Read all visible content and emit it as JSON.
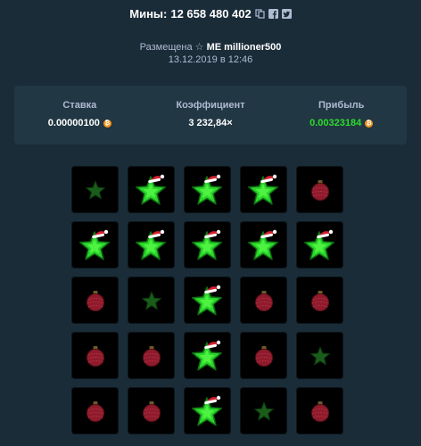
{
  "header": {
    "title_prefix": "Мины: ",
    "game_id": "12 658 480 402",
    "icons": [
      "copy-icon",
      "facebook-icon",
      "twitter-icon"
    ]
  },
  "meta": {
    "posted_label": "Размещена",
    "user_level": "ME",
    "username": "millioner500",
    "datetime": "13.12.2019 в 12:46"
  },
  "stats": {
    "bet_label": "Ставка",
    "bet_value": "0.00000100",
    "multiplier_label": "Коэффициент",
    "multiplier_value": "3 232,84×",
    "profit_label": "Прибыль",
    "profit_value": "0.00323184",
    "currency_icon": "bitcoin-icon"
  },
  "colors": {
    "background": "#1a2c38",
    "panel": "#213743",
    "profit_green": "#2ddc2d",
    "gem": "#2bd52b",
    "mine": "#8e1b2b"
  },
  "board": [
    [
      "star-dim",
      "star",
      "star",
      "star",
      "mine"
    ],
    [
      "star",
      "star",
      "star",
      "star",
      "star"
    ],
    [
      "mine",
      "star-dim",
      "star",
      "mine",
      "mine"
    ],
    [
      "mine",
      "mine",
      "star",
      "mine",
      "star-dim"
    ],
    [
      "mine",
      "mine",
      "star",
      "star-dim",
      "mine"
    ]
  ]
}
